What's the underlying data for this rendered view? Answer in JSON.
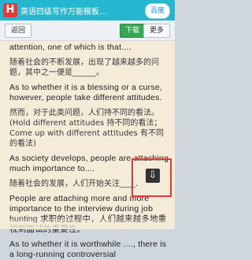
{
  "topbar": {
    "app_icon": "H",
    "title": "英语四级写作万能模板...",
    "baidu_label": "百度"
  },
  "toolbar": {
    "back_label": "返回",
    "download_label": "下载",
    "more_label": "更多"
  },
  "document": {
    "lines": [
      {
        "lang": "en",
        "text": "attention, one of which is that...."
      },
      {
        "lang": "cn",
        "text": "随着社会的不断发展，出现了越来越多的问题，其中之一便是______。"
      },
      {
        "lang": "en",
        "text": "As to whether it is a blessing or a curse, however, people take different attitudes."
      },
      {
        "lang": "cn",
        "text": "然而，对于此类问题，人们持不同的看法。(Hold different attitudes 持不同的看法；Come up with different attitudes 有不同的看法)"
      },
      {
        "lang": "en",
        "text": "As society develops, people are attaching much importance to...."
      },
      {
        "lang": "cn",
        "text": "随着社会的发展，人们开始关注____."
      },
      {
        "lang": "en",
        "text": "People are attaching more and more importance to the interview during job hunting 求职的过程中，人们越来越多地重视到面试的重要性。"
      },
      {
        "lang": "en",
        "text": "As to whether it is worthwhile ...., there is a long-running controversial"
      }
    ]
  },
  "overlay": {
    "download_icon": "download-icon"
  }
}
